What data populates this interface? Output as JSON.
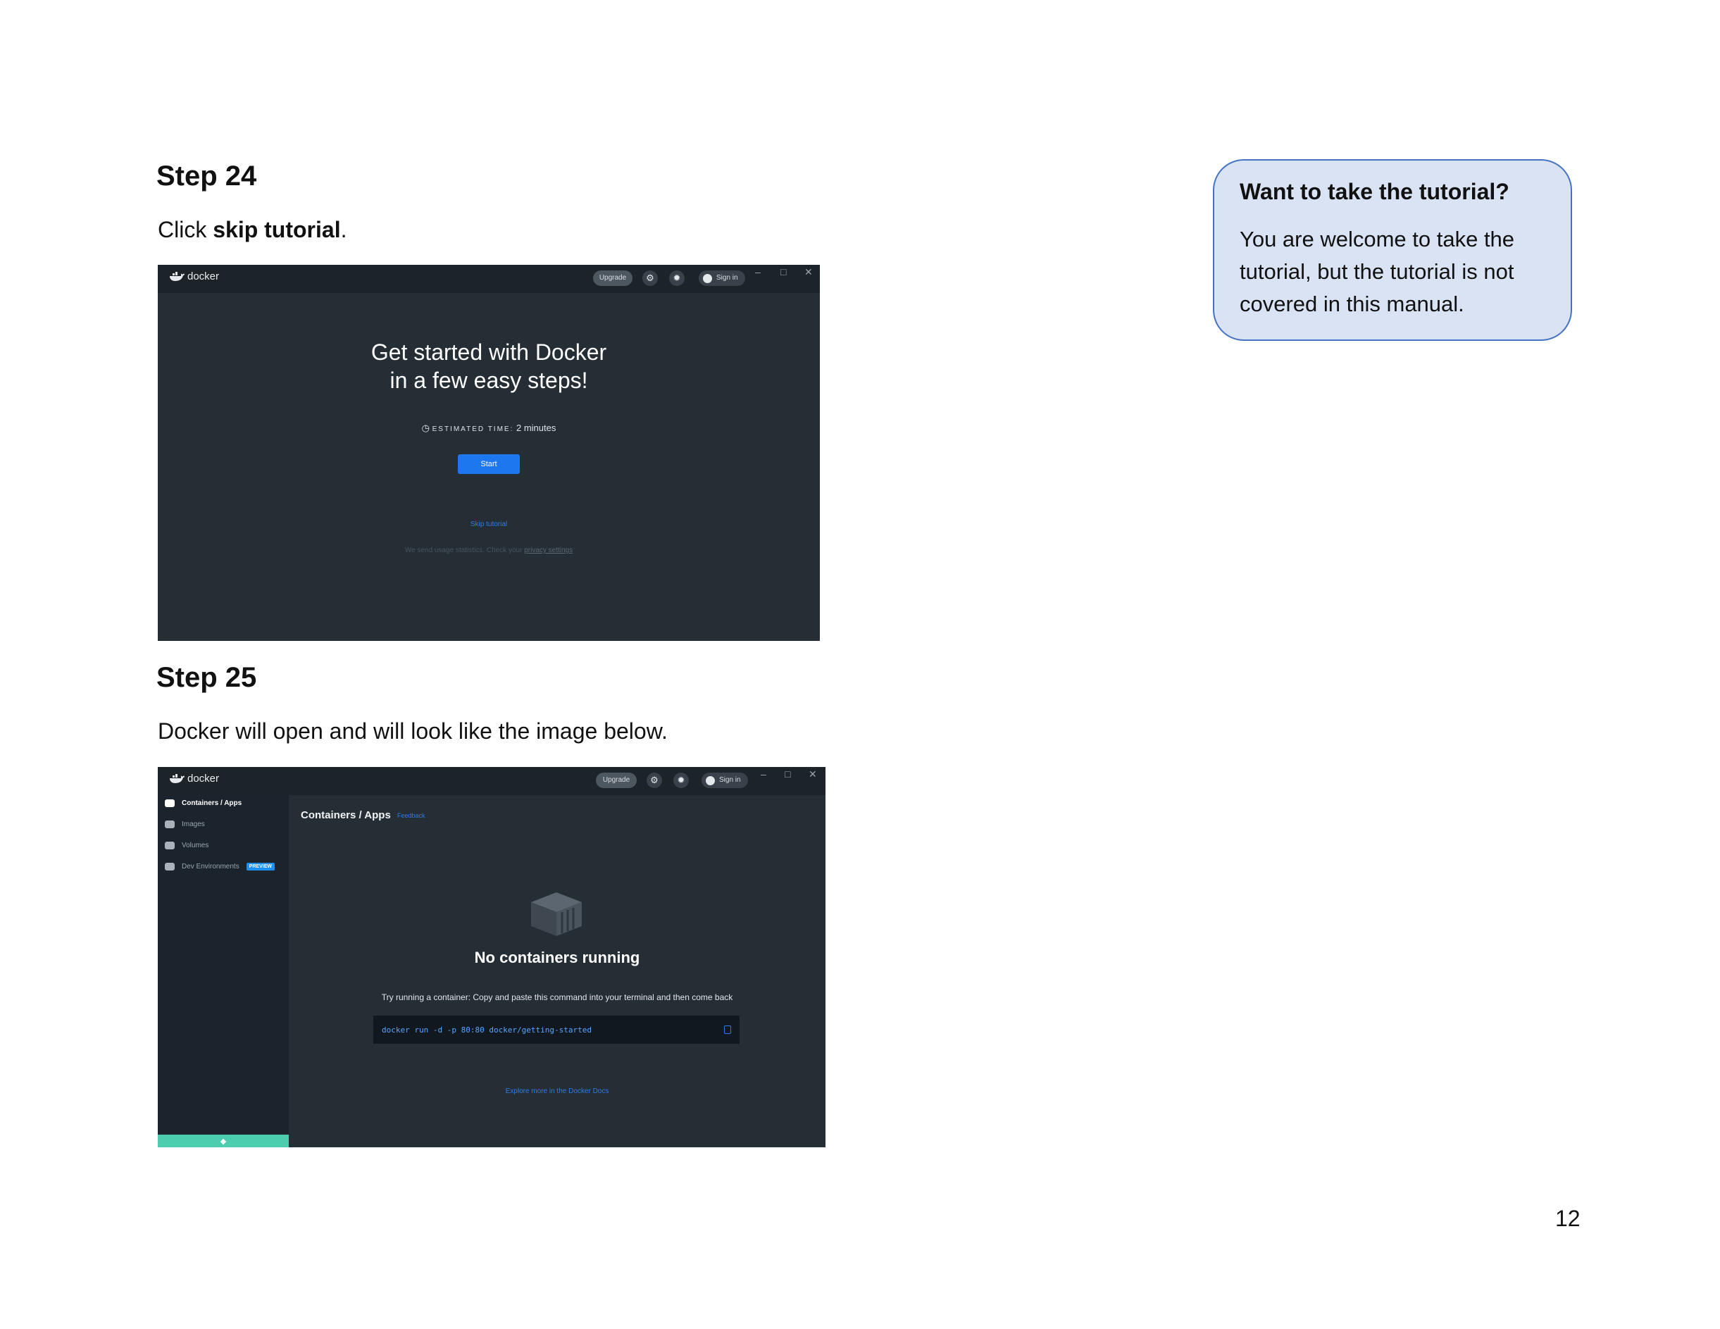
{
  "step24": {
    "title": "Step 24",
    "instruction_prefix": "Click ",
    "instruction_bold": "skip tutorial",
    "instruction_suffix": ".",
    "screenshot": {
      "logo_text": "docker",
      "upgrade_label": "Upgrade",
      "signin_label": "Sign in",
      "heading_line1": "Get started with Docker",
      "heading_line2": "in a few easy steps!",
      "estimated_label": "ESTIMATED TIME:",
      "estimated_value": "2 minutes",
      "start_label": "Start",
      "skip_label": "Skip tutorial",
      "usage_text": "We send usage statistics. Check your ",
      "privacy_link": "privacy settings"
    }
  },
  "step25": {
    "title": "Step 25",
    "instruction": "Docker will open and will look like the image below.",
    "screenshot": {
      "logo_text": "docker",
      "upgrade_label": "Upgrade",
      "signin_label": "Sign in",
      "sidebar": [
        {
          "label": "Containers / Apps"
        },
        {
          "label": "Images"
        },
        {
          "label": "Volumes"
        },
        {
          "label": "Dev Environments",
          "badge": "PREVIEW"
        }
      ],
      "main_title": "Containers / Apps",
      "feedback_label": "Feedback",
      "empty_title": "No containers running",
      "try_text": "Try running a container: Copy and paste this command into your terminal and then come back",
      "command": "docker run -d -p 80:80 docker/getting-started",
      "explore_link": "Explore more in the Docker Docs"
    }
  },
  "callout": {
    "title": "Want to take the tutorial?",
    "body": "You are welcome to take the tutorial, but the tutorial is not covered in this manual."
  },
  "page_number": "12",
  "colors": {
    "docker_bg": "#252d35",
    "docker_blue": "#1d77ef",
    "callout_bg": "#dae3f3",
    "callout_border": "#4472c4",
    "sidebar_footer": "#4ccdaf"
  }
}
